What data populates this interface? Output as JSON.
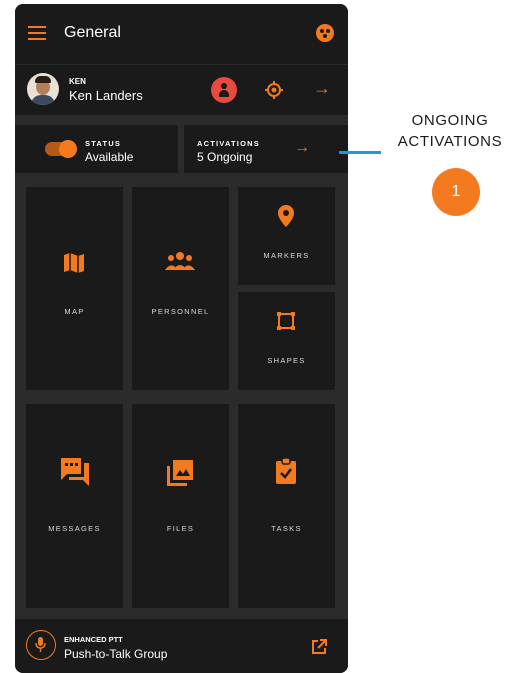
{
  "appbar": {
    "title": "General",
    "menu_icon": "menu-icon",
    "app_icon": "app-logo-icon"
  },
  "user": {
    "callsign": "KEN",
    "name": "Ken Landers"
  },
  "status": {
    "label": "STATUS",
    "value": "Available",
    "toggle_on": true
  },
  "activations": {
    "label": "ACTIVATIONS",
    "value": "5 Ongoing"
  },
  "tiles": {
    "map": "MAP",
    "personnel": "PERSONNEL",
    "markers": "MARKERS",
    "shapes": "SHAPES",
    "messages": "MESSAGES",
    "files": "FILES",
    "tasks": "TASKS"
  },
  "ptt": {
    "label": "ENHANCED PTT",
    "value": "Push-to-Talk Group"
  },
  "callout": {
    "line1": "ONGOING",
    "line2": "ACTIVATIONS",
    "badge": "1"
  },
  "colors": {
    "accent": "#f47a20",
    "background": "#2b2b2b",
    "surface": "#1a1a1a",
    "alert": "#e94a3f",
    "callout": "#1a9ad6"
  }
}
